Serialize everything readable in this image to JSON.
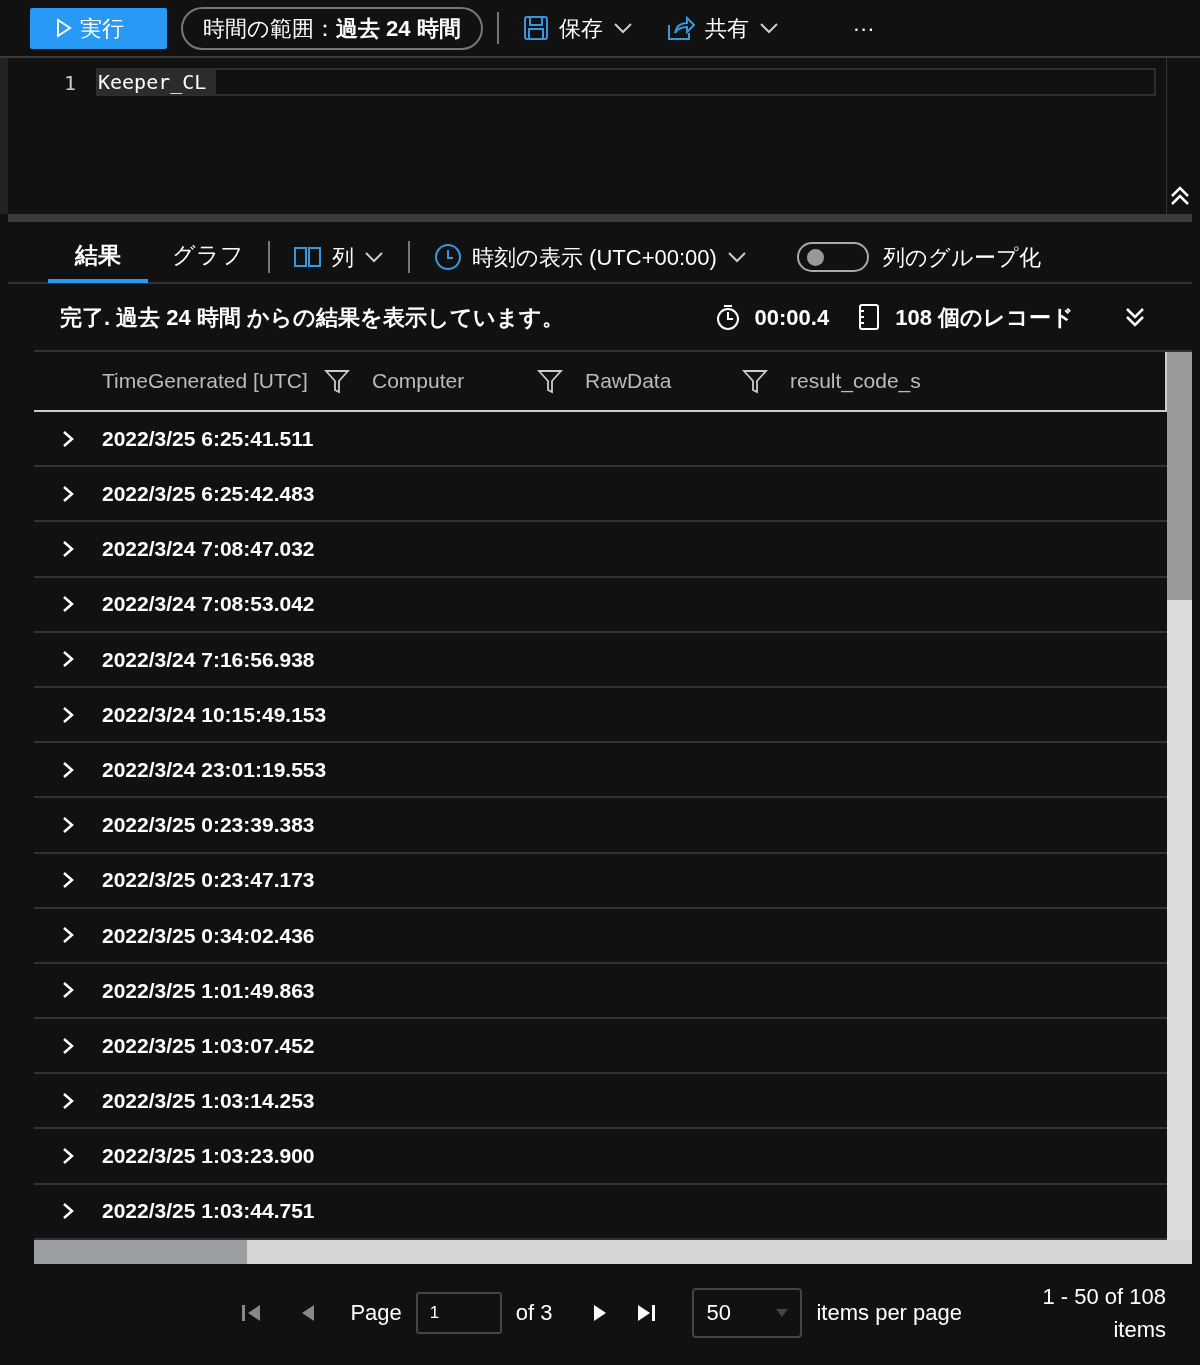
{
  "toolbar": {
    "run_button": "実行",
    "time_range": {
      "label": "時間の範囲：",
      "value": "過去 24 時間"
    },
    "save_button": "保存",
    "share_button": "共有",
    "more_button": "···"
  },
  "editor": {
    "line_number": "1",
    "query": "Keeper_CL"
  },
  "results": {
    "tabs": [
      {
        "label": "結果",
        "selected": true
      },
      {
        "label": "グラフ",
        "selected": false
      }
    ],
    "columns_button": "列",
    "time_display": "時刻の表示 (UTC+00:00)",
    "group_toggle": {
      "label": "列のグループ化",
      "on": false
    }
  },
  "status": {
    "message": "**完了**. 過去 24 時間 からの結果を表示しています。",
    "duration": "00:00.4",
    "records": "108 個のレコード"
  },
  "table": {
    "columns": [
      "TimeGenerated [UTC]",
      "Computer",
      "RawData",
      "result_code_s"
    ],
    "rows": [
      "2022/3/25 6:25:41.511",
      "2022/3/25 6:25:42.483",
      "2022/3/24 7:08:47.032",
      "2022/3/24 7:08:53.042",
      "2022/3/24 7:16:56.938",
      "2022/3/24 10:15:49.153",
      "2022/3/24 23:01:19.553",
      "2022/3/25 0:23:39.383",
      "2022/3/25 0:23:47.173",
      "2022/3/25 0:34:02.436",
      "2022/3/25 1:01:49.863",
      "2022/3/25 1:03:07.452",
      "2022/3/25 1:03:14.253",
      "2022/3/25 1:03:23.900",
      "2022/3/25 1:03:44.751"
    ]
  },
  "pagination": {
    "page_label": "Page",
    "page_value": "1",
    "of_pages": "of 3",
    "page_size": "50",
    "per_page_label": "items per page",
    "range": "1 - 50 of 108 items"
  }
}
